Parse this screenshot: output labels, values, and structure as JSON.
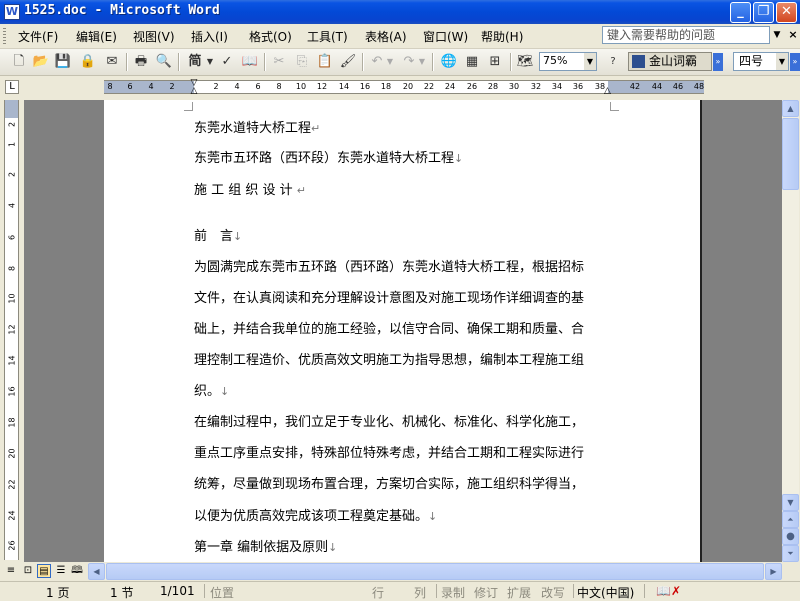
{
  "window": {
    "title": "1525.doc - Microsoft Word",
    "app_icon": "W",
    "minimize_icon": "_",
    "maximize_icon": "❐",
    "close_icon": "✕"
  },
  "menu": {
    "items": [
      "文件(F)",
      "编辑(E)",
      "视图(V)",
      "插入(I)",
      "格式(O)",
      "工具(T)",
      "表格(A)",
      "窗口(W)",
      "帮助(H)"
    ],
    "help_placeholder": "键入需要帮助的问题",
    "close_glyph": "×"
  },
  "toolbar": {
    "zoom": "75%",
    "jinshan_label": "金山词霸",
    "font_size": "四号",
    "font_glyph": "简"
  },
  "ruler": {
    "h_numbers": [
      "8",
      "6",
      "4",
      "2",
      "2",
      "4",
      "6",
      "8",
      "10",
      "12",
      "14",
      "16",
      "18",
      "20",
      "22",
      "24",
      "26",
      "28",
      "30",
      "32",
      "34",
      "36",
      "38",
      "42",
      "44",
      "46",
      "48"
    ],
    "v_numbers": [
      "2",
      "1",
      "2",
      "4",
      "6",
      "8",
      "10",
      "12",
      "14",
      "16",
      "18",
      "20",
      "22",
      "24",
      "26",
      "28"
    ]
  },
  "document": {
    "lines": [
      "东莞水道特大桥工程",
      "东莞市五环路（西环段）东莞水道特大桥工程",
      "施 工 组 织 设 计 ",
      "前　言",
      "为圆满完成东莞市五环路（西环路）东莞水道特大桥工程，根据招标",
      "文件，在认真阅读和充分理解设计意图及对施工现场作详细调查的基",
      "础上，并结合我单位的施工经验，以信守合同、确保工期和质量、合",
      "理控制工程造价、优质高效文明施工为指导思想，编制本工程施工组",
      "织。",
      "在编制过程中，我们立足于专业化、机械化、标准化、科学化施工，",
      "重点工序重点安排，特殊部位特殊考虑，并结合工期和工程实际进行",
      "统筹，尽量做到现场布置合理，方案切合实际，施工组织科学得当，",
      "以便为优质高效完成该项工程奠定基础。",
      "第一章  编制依据及原则"
    ],
    "marks": [
      "↵",
      "↓",
      "↵",
      "↓",
      "",
      "",
      "",
      "",
      "↓",
      "",
      "",
      "",
      "↓",
      "↓"
    ]
  },
  "status": {
    "page": "1 页",
    "section": "1 节",
    "page_of": "1/101",
    "position": "位置",
    "line": "行",
    "col": "列",
    "rec": "录制",
    "trk": "修订",
    "ext": "扩展",
    "ovr": "改写",
    "language": "中文(中国)"
  }
}
